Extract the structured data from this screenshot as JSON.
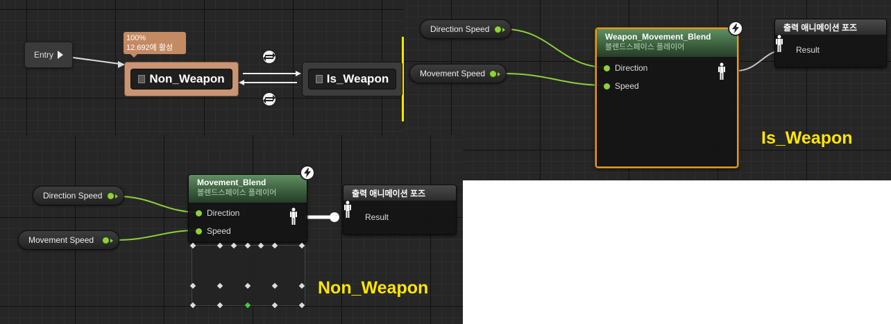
{
  "state_machine": {
    "entry_label": "Entry",
    "note_weight": "100%",
    "note_time": "12.692에 활성",
    "state_non_weapon": "Non_Weapon",
    "state_is_weapon": "Is_Weapon"
  },
  "is_weapon_graph": {
    "var_direction": "Direction Speed",
    "var_movement": "Movement Speed",
    "blend_title": "Weapon_Movement_Blend",
    "blend_subtitle": "블렌드스페이스 플레이어",
    "pin_direction": "Direction",
    "pin_speed": "Speed",
    "output_title": "출력 애니메이션 포즈",
    "output_pin": "Result",
    "label": "Is_Weapon"
  },
  "non_weapon_graph": {
    "var_direction": "Direction Speed",
    "var_movement": "Movement Speed",
    "blend_title": "Movement_Blend",
    "blend_subtitle": "블렌드스페이스 플레이어",
    "pin_direction": "Direction",
    "pin_speed": "Speed",
    "output_title": "출력 애니메이션 포즈",
    "output_pin": "Result",
    "label": "Non_Weapon"
  },
  "colors": {
    "highlight_yellow": "#ffe600",
    "pin_green": "#8fd13a",
    "active_state": "#c48a62",
    "selected_node_border": "#e89a1d",
    "blend_header": "#4a7a4d"
  },
  "icons": {
    "entry": "play-triangle-icon",
    "transition": "transition-arrows-icon",
    "blend_node": "lightning-bolt-icon",
    "pose": "mannequin-icon"
  }
}
